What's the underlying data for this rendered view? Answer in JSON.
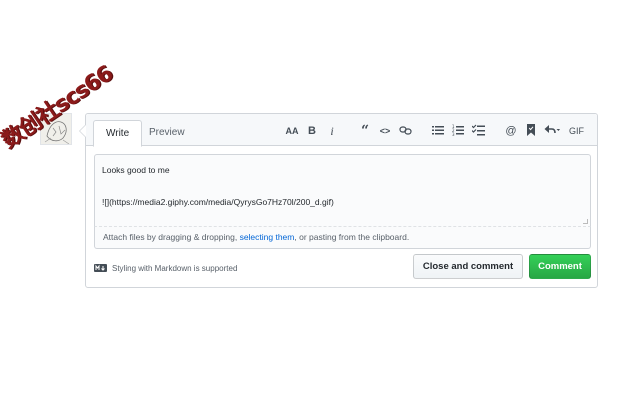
{
  "tabs": {
    "write_label": "Write",
    "preview_label": "Preview"
  },
  "toolbar": {
    "heading_label": "AA",
    "bold_label": "B",
    "italic_label": "i",
    "quote_label": "“",
    "code_label": "<>",
    "mention_label": "@",
    "gif_label": "GIF",
    "icons": [
      "text-size-icon",
      "bold-icon",
      "italic-icon",
      "quote-icon",
      "code-icon",
      "link-icon",
      "unordered-list-icon",
      "ordered-list-icon",
      "task-list-icon",
      "mention-icon",
      "bookmark-icon",
      "reply-icon",
      "gif-icon"
    ]
  },
  "editor": {
    "lines": [
      "Looks good to me",
      "",
      "![](https://media2.giphy.com/media/QyrysGo7Hz70l/200_d.gif)"
    ]
  },
  "dropzone": {
    "text_before": "Attach files by dragging & dropping, ",
    "link_text": "selecting them",
    "text_after": ", or pasting from the clipboard."
  },
  "footer": {
    "markdown_note": "Styling with Markdown is supported"
  },
  "buttons": {
    "close_and_comment": "Close and comment",
    "comment": "Comment"
  },
  "watermark": {
    "text": "数创社scs66"
  },
  "colors": {
    "primary_button": "#28a745",
    "link": "#0366d6",
    "border": "#d1d5da",
    "watermark": "#8b1a1a"
  }
}
